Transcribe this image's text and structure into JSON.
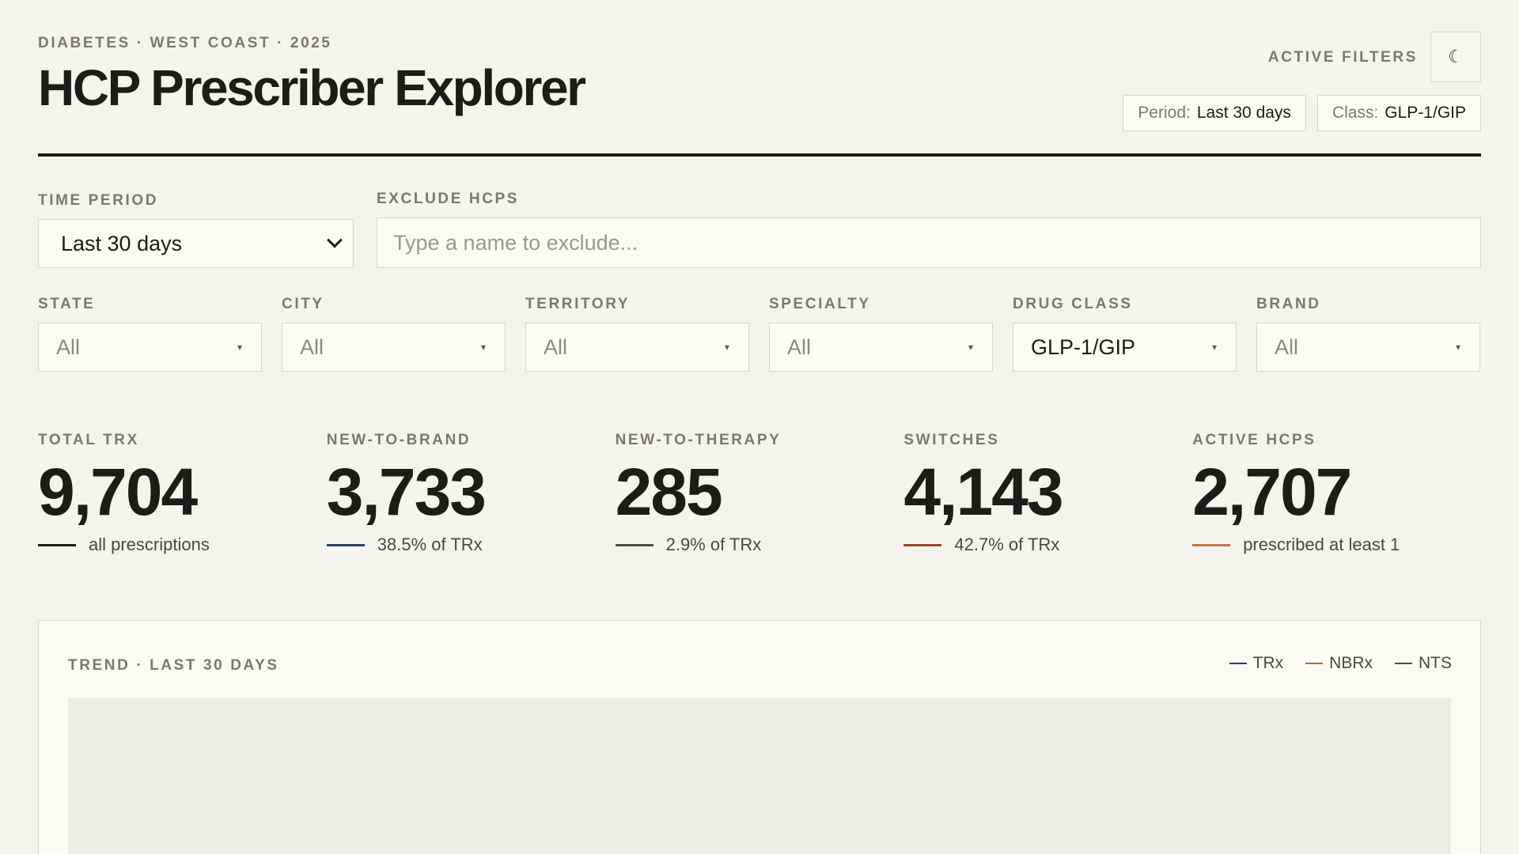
{
  "header": {
    "eyebrow": "DIABETES · WEST COAST · 2025",
    "title": "HCP Prescriber Explorer",
    "active_filters_label": "ACTIVE FILTERS",
    "theme_icon": "moon-icon",
    "chips": [
      {
        "key": "Period:",
        "value": "Last 30 days"
      },
      {
        "key": "Class:",
        "value": "GLP-1/GIP"
      }
    ]
  },
  "controls": {
    "time_period": {
      "label": "TIME PERIOD",
      "value": "Last 30 days"
    },
    "exclude": {
      "label": "EXCLUDE HCPS",
      "placeholder": "Type a name to exclude..."
    },
    "dropdowns": [
      {
        "label": "STATE",
        "value": "All"
      },
      {
        "label": "CITY",
        "value": "All"
      },
      {
        "label": "TERRITORY",
        "value": "All"
      },
      {
        "label": "SPECIALTY",
        "value": "All"
      },
      {
        "label": "DRUG CLASS",
        "value": "GLP-1/GIP"
      },
      {
        "label": "BRAND",
        "value": "All"
      }
    ]
  },
  "kpis": [
    {
      "label": "TOTAL TRX",
      "value": "9,704",
      "sub": "all prescriptions",
      "color": "#1d1c1a"
    },
    {
      "label": "NEW-TO-BRAND",
      "value": "3,733",
      "sub": "38.5% of TRx",
      "color": "#2b3f6b"
    },
    {
      "label": "NEW-TO-THERAPY",
      "value": "285",
      "sub": "2.9% of TRx",
      "color": "#4a4f4b"
    },
    {
      "label": "SWITCHES",
      "value": "4,143",
      "sub": "42.7% of TRx",
      "color": "#9a4a25"
    },
    {
      "label": "ACTIVE HCPS",
      "value": "2,707",
      "sub": "prescribed at least 1",
      "color": "#c07a4f"
    }
  ],
  "trend": {
    "title": "TREND · LAST 30 DAYS",
    "legend": [
      {
        "label": "TRx",
        "color": "#2b3f6b"
      },
      {
        "label": "NBRx",
        "color": "#b06a3c"
      },
      {
        "label": "NTS",
        "color": "#4a4f4b"
      }
    ]
  }
}
